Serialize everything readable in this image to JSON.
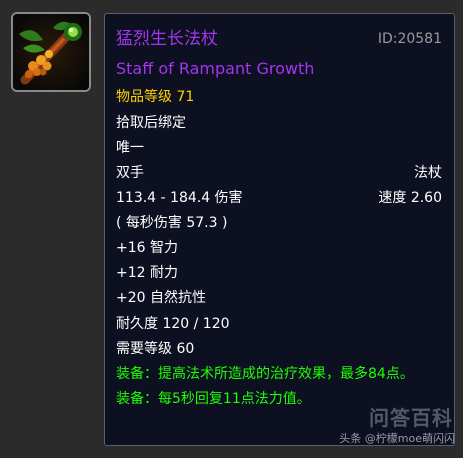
{
  "item": {
    "name_cn": "猛烈生长法杖",
    "id_label": "ID:20581",
    "name_en": "Staff of Rampant Growth",
    "item_level": "物品等级 71",
    "binding": "拾取后绑定",
    "unique": "唯一",
    "slot": "双手",
    "type": "法杖",
    "damage": "113.4 - 184.4 伤害",
    "speed": "速度 2.60",
    "dps": "( 每秒伤害 57.3 )",
    "stats": [
      "+16 智力",
      "+12 耐力",
      "+20 自然抗性"
    ],
    "durability": "耐久度 120 / 120",
    "required_level": "需要等级 60",
    "equip_effects": [
      "装备：提高法术所造成的治疗效果，最多84点。",
      "装备：每5秒回复11点法力值。"
    ]
  },
  "watermark": {
    "big": "问答百科",
    "small": "头条 @柠檬moe萌闪闪"
  },
  "colors": {
    "epic": "#a335ee",
    "item_level": "#ffd100",
    "equip": "#1eff00",
    "background": "#0d1021"
  },
  "icon": "staff-of-rampant-growth-icon"
}
